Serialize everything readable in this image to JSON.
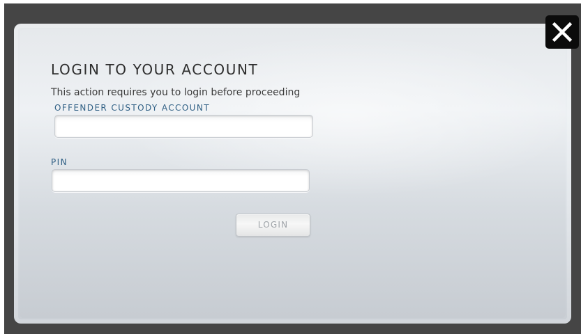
{
  "dialog": {
    "title": "LOGIN TO YOUR ACCOUNT",
    "subtitle": "This action requires you to login before proceeding",
    "close_icon": "close-icon"
  },
  "form": {
    "account_label": "OFFENDER CUSTODY ACCOUNT",
    "account_value": "",
    "account_placeholder": "",
    "pin_label": "PIN",
    "pin_value": "",
    "pin_placeholder": "",
    "login_label": "LOGIN",
    "login_enabled": false
  },
  "colors": {
    "backdrop": "#454545",
    "label_accent": "#2f5f84",
    "close_button_bg": "#0b0b0b"
  }
}
